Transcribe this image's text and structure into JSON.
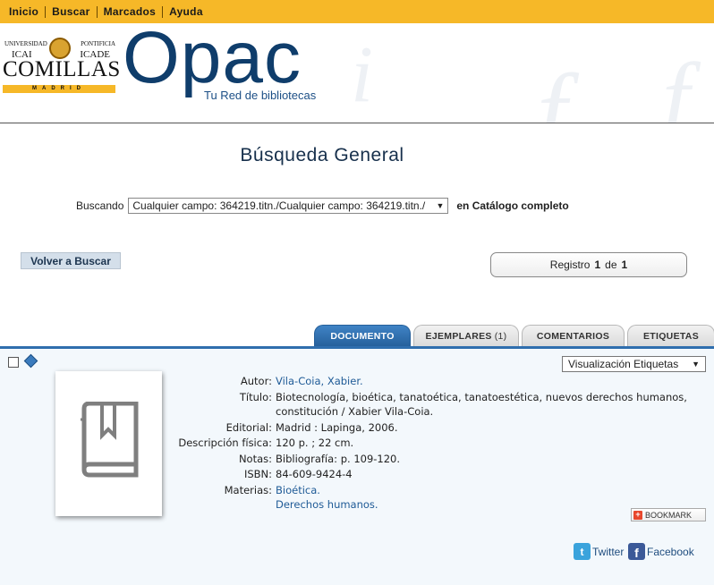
{
  "topnav": {
    "items": [
      {
        "label": "Inicio"
      },
      {
        "label": "Buscar"
      },
      {
        "label": "Marcados"
      },
      {
        "label": "Ayuda"
      }
    ]
  },
  "logo": {
    "top_left": "UNIVERSIDAD",
    "top_right": "PONTIFICIA",
    "mid_left": "ICAI",
    "mid_right": "ICADE",
    "name": "COMILLAS",
    "city": "MADRID"
  },
  "brand": {
    "title": "Opac",
    "subtitle": "Tu Red de bibliotecas"
  },
  "page": {
    "title": "Búsqueda General"
  },
  "search": {
    "label": "Buscando",
    "query": "Cualquier campo: 364219.titn./Cualquier campo: 364219.titn./",
    "scope": "en Catálogo completo"
  },
  "actions": {
    "back_label": "Volver a Buscar"
  },
  "record": {
    "prefix": "Registro",
    "current": "1",
    "of": "de",
    "total": "1"
  },
  "tabs": [
    {
      "label": "DOCUMENTO",
      "active": true
    },
    {
      "label": "EJEMPLARES",
      "count": "(1)"
    },
    {
      "label": "COMENTARIOS"
    },
    {
      "label": "ETIQUETAS"
    }
  ],
  "view": {
    "selected": "Visualización Etiquetas"
  },
  "fields": {
    "autor": {
      "label": "Autor:",
      "value": "Vila-Coia, Xabier."
    },
    "titulo": {
      "label": "Título:",
      "value": "Biotecnología, bioética, tanatoética, tanatoestética, nuevos derechos humanos, constitución / Xabier Vila-Coia."
    },
    "editorial": {
      "label": "Editorial:",
      "value": "Madrid : Lapinga, 2006."
    },
    "descripcion": {
      "label": "Descripción física:",
      "value": "120 p. ; 22 cm."
    },
    "notas": {
      "label": "Notas:",
      "value": "Bibliografía: p. 109-120."
    },
    "isbn": {
      "label": "ISBN:",
      "value": "84-609-9424-4"
    },
    "materias": {
      "label": "Materias:",
      "values": [
        "Bioética.",
        "Derechos humanos."
      ]
    }
  },
  "bookmark": {
    "label": "BOOKMARK"
  },
  "social": {
    "twitter": "Twitter",
    "facebook": "Facebook"
  },
  "colors": {
    "nav_bg": "#f6b828",
    "brand_blue": "#0f3d6b",
    "tab_active": "#2f6eae",
    "panel_bg": "#f3f8fc"
  }
}
